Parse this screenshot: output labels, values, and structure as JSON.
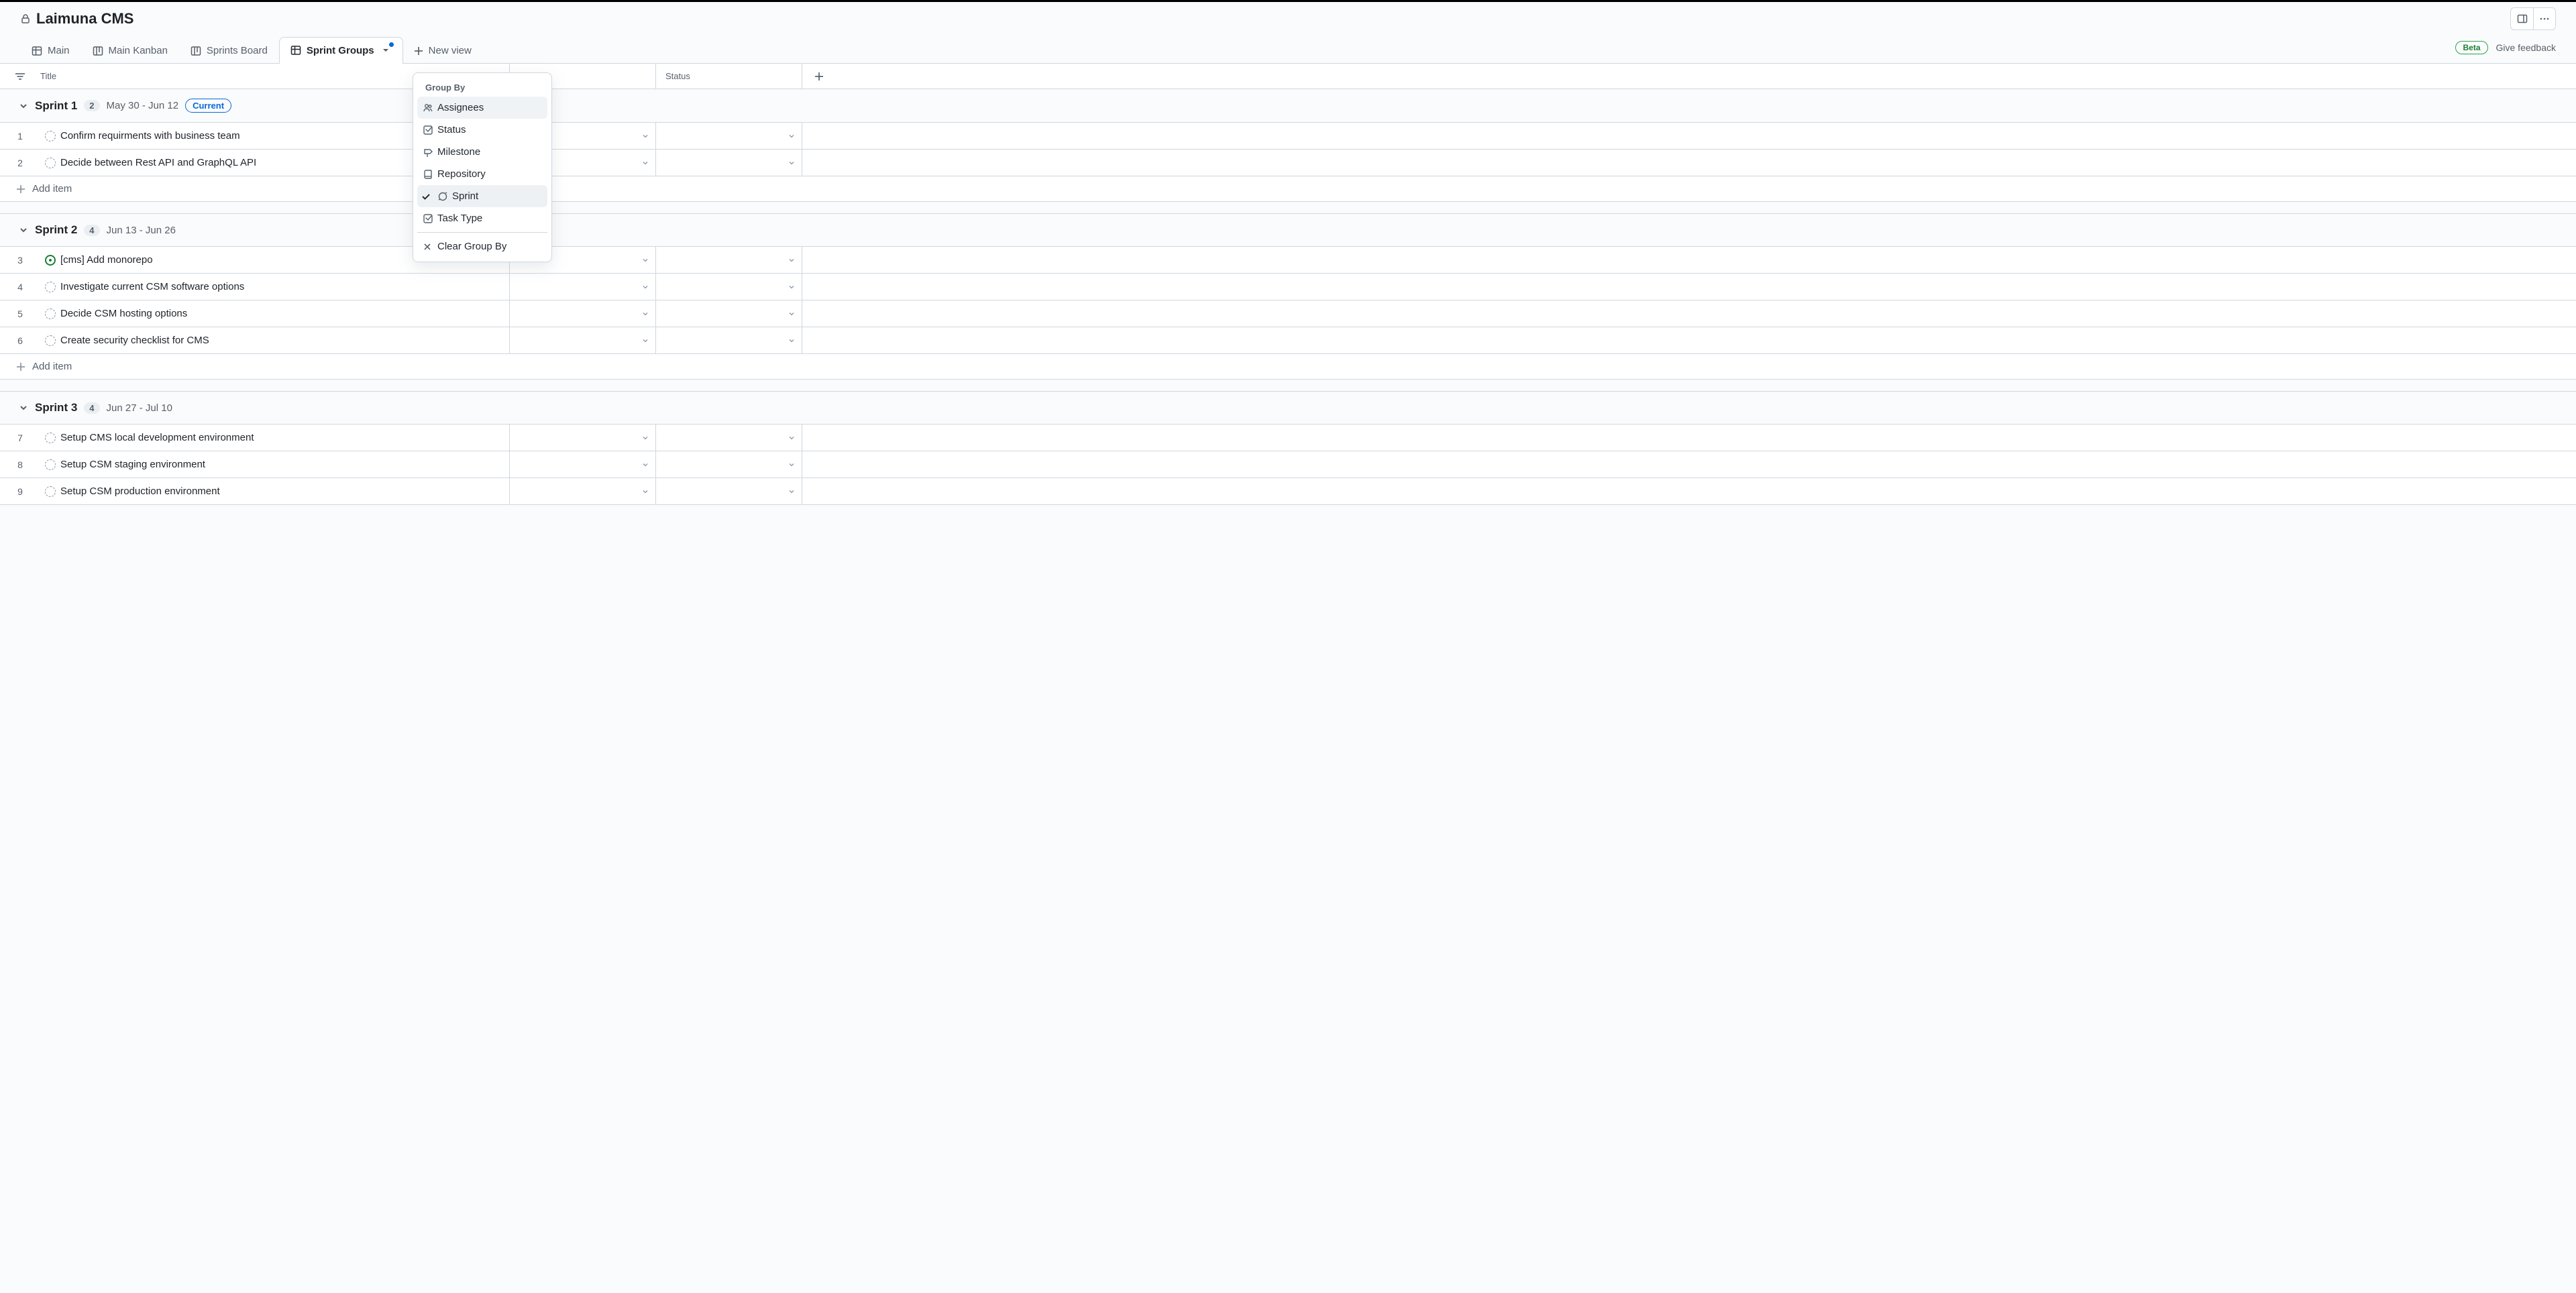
{
  "project": {
    "title": "Laimuna CMS"
  },
  "tabs": {
    "main": "Main",
    "main_kanban": "Main Kanban",
    "sprints_board": "Sprints Board",
    "sprint_groups": "Sprint Groups",
    "new_view": "New view"
  },
  "beta_label": "Beta",
  "feedback_label": "Give feedback",
  "columns": {
    "title": "Title",
    "assignees_partial": "es",
    "status": "Status"
  },
  "menu": {
    "title": "Group By",
    "assignees": "Assignees",
    "status": "Status",
    "milestone": "Milestone",
    "repository": "Repository",
    "sprint": "Sprint",
    "task_type": "Task Type",
    "clear": "Clear Group By"
  },
  "groups": [
    {
      "name": "Sprint 1",
      "count": "2",
      "dates": "May 30 - Jun 12",
      "current": "Current",
      "rows": [
        {
          "num": "1",
          "icon": "draft",
          "title": "Confirm requirments with business team"
        },
        {
          "num": "2",
          "icon": "draft",
          "title": "Decide between Rest API and GraphQL API"
        }
      ]
    },
    {
      "name": "Sprint 2",
      "count": "4",
      "dates": "Jun 13 - Jun 26",
      "rows": [
        {
          "num": "3",
          "icon": "open",
          "title": "[cms] Add monorepo"
        },
        {
          "num": "4",
          "icon": "draft",
          "title": "Investigate current CSM software options"
        },
        {
          "num": "5",
          "icon": "draft",
          "title": "Decide CSM hosting options"
        },
        {
          "num": "6",
          "icon": "draft",
          "title": "Create security checklist for CMS"
        }
      ]
    },
    {
      "name": "Sprint 3",
      "count": "4",
      "dates": "Jun 27 - Jul 10",
      "rows": [
        {
          "num": "7",
          "icon": "draft",
          "title": "Setup CMS local development environment"
        },
        {
          "num": "8",
          "icon": "draft",
          "title": "Setup CSM staging environment"
        },
        {
          "num": "9",
          "icon": "draft",
          "title": "Setup CSM production environment"
        }
      ]
    }
  ],
  "add_item_label": "Add item"
}
